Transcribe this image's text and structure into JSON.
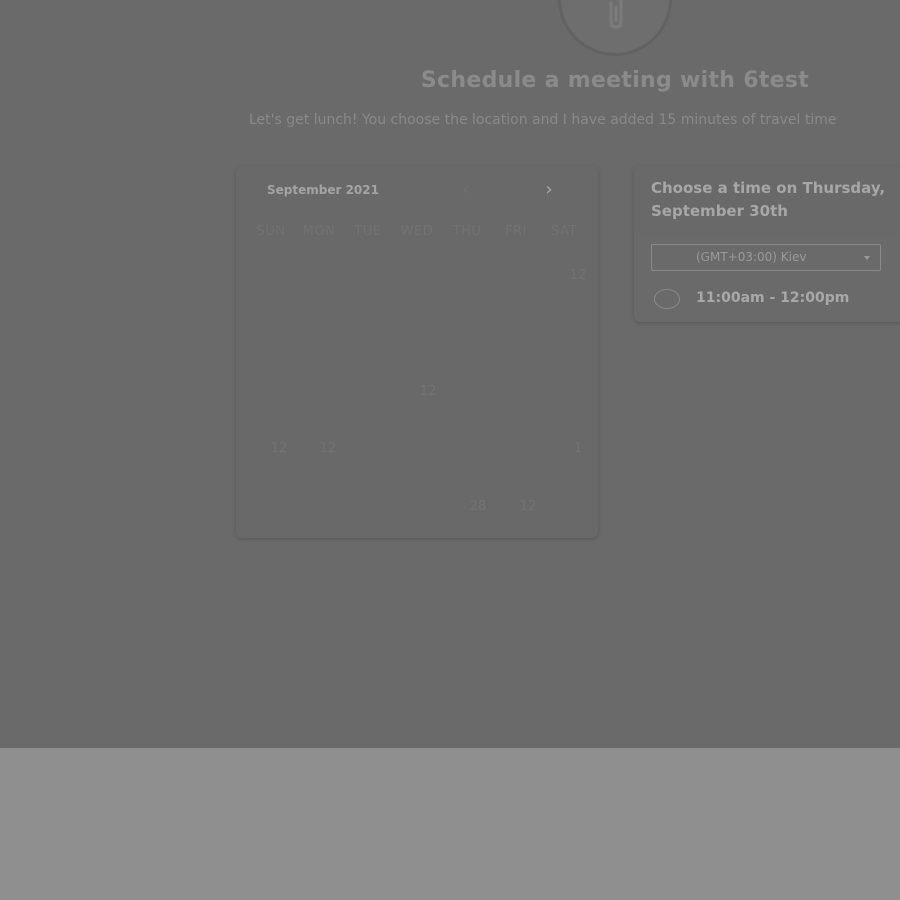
{
  "header": {
    "title": "Schedule a meeting with 6test",
    "subtitle": "Let's get lunch! You choose the location and I have added 15 minutes of travel time"
  },
  "calendar": {
    "month_label": "September 2021",
    "prev_icon": "‹",
    "next_icon": "›",
    "weekdays": [
      "SUN",
      "MON",
      "TUE",
      "WED",
      "THU",
      "FRI",
      "SAT"
    ],
    "visible_days": [
      "12",
      "12",
      "12",
      "12",
      "1",
      "28",
      "12"
    ]
  },
  "time_panel": {
    "heading_line1": "Choose a time on Thursday,",
    "heading_line2": "September 30th",
    "timezone": "(GMT+03:00) Kiev",
    "slot": "11:00am - 12:00pm"
  }
}
